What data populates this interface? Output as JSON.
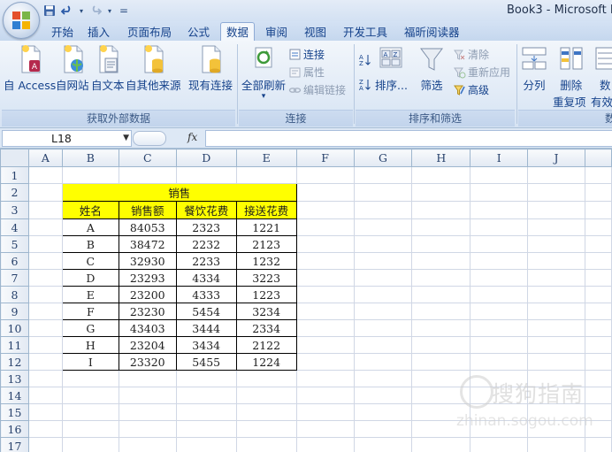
{
  "window": {
    "title": "Book3 - Microsoft E"
  },
  "qat": {
    "save": "save-icon",
    "undo": "undo-icon",
    "redo": "redo-icon",
    "more": "="
  },
  "tabs": [
    {
      "label": "开始"
    },
    {
      "label": "插入"
    },
    {
      "label": "页面布局"
    },
    {
      "label": "公式"
    },
    {
      "label": "数据"
    },
    {
      "label": "审阅"
    },
    {
      "label": "视图"
    },
    {
      "label": "开发工具"
    },
    {
      "label": "福昕阅读器"
    }
  ],
  "active_tab": "数据",
  "ribbon": {
    "get_external": {
      "label": "获取外部数据",
      "access": "自 Access",
      "web": "自网站",
      "text": "自文本",
      "other": "自其他来源",
      "existing": "现有连接"
    },
    "connections": {
      "label": "连接",
      "refresh_all": "全部刷新",
      "connections": "连接",
      "properties": "属性",
      "edit_links": "编辑链接"
    },
    "sort_filter": {
      "label": "排序和筛选",
      "sort_az": "A→Z",
      "sort_za": "Z→A",
      "sort": "排序...",
      "filter": "筛选",
      "clear": "清除",
      "reapply": "重新应用",
      "advanced": "高级"
    },
    "data_tools": {
      "label": "数",
      "split_cols": "分列",
      "remove_dup_1": "删除",
      "remove_dup_2": "重复项",
      "validate_1": "数",
      "validate_2": "有效"
    }
  },
  "formula_bar": {
    "name_box": "L18",
    "fx": "fx",
    "formula": ""
  },
  "sheet": {
    "columns": [
      "A",
      "B",
      "C",
      "D",
      "E",
      "F",
      "G",
      "H",
      "I",
      "J"
    ],
    "rows": [
      "1",
      "2",
      "3",
      "4",
      "5",
      "6",
      "7",
      "8",
      "9",
      "10",
      "11",
      "12",
      "13",
      "14",
      "15",
      "16",
      "17"
    ],
    "table_title": "销售",
    "headers": [
      "姓名",
      "销售额",
      "餐饮花费",
      "接送花费"
    ],
    "data": [
      [
        "A",
        "84053",
        "2323",
        "1221"
      ],
      [
        "B",
        "38472",
        "2232",
        "2123"
      ],
      [
        "C",
        "32930",
        "2233",
        "1232"
      ],
      [
        "D",
        "23293",
        "4334",
        "3223"
      ],
      [
        "E",
        "23200",
        "4333",
        "1223"
      ],
      [
        "F",
        "23230",
        "5454",
        "3234"
      ],
      [
        "G",
        "43403",
        "3444",
        "2334"
      ],
      [
        "H",
        "23204",
        "3434",
        "2122"
      ],
      [
        "I",
        "23320",
        "5455",
        "1224"
      ]
    ],
    "header_color": "#ffff00"
  },
  "watermark": {
    "cn": "搜狗指南",
    "en": "zhinan.sogou.com"
  }
}
